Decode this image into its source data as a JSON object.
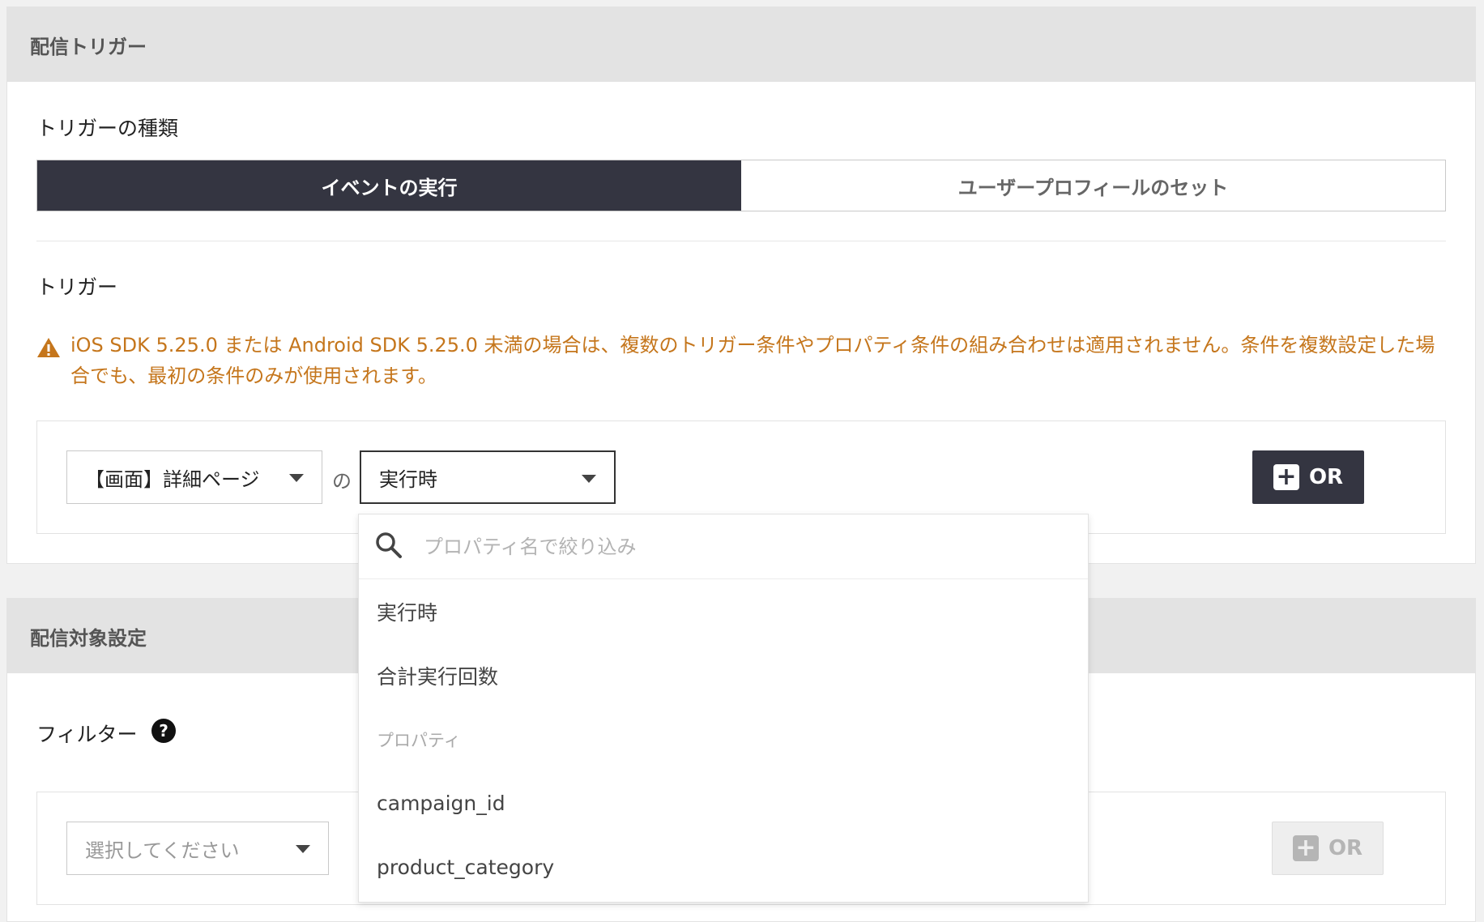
{
  "delivery_trigger_section": {
    "title": "配信トリガー",
    "trigger_type_label": "トリガーの種類",
    "trigger_type_options": [
      {
        "label": "イベントの実行",
        "active": true
      },
      {
        "label": "ユーザープロフィールのセット",
        "active": false
      }
    ],
    "trigger_label": "トリガー",
    "warning": "iOS SDK 5.25.0 または Android SDK 5.25.0 未満の場合は、複数のトリガー条件やプロパティ条件の組み合わせは適用されません。条件を複数設定した場合でも、最初の条件のみが使用されます。",
    "condition": {
      "event_select_value": "【画面】詳細ページ",
      "connector_text": "の",
      "property_select_value": "実行時",
      "or_button_label": "OR"
    }
  },
  "dropdown": {
    "search_placeholder": "プロパティ名で絞り込み",
    "items": [
      "実行時",
      "合計実行回数"
    ],
    "group_label": "プロパティ",
    "property_items": [
      "campaign_id",
      "product_category"
    ]
  },
  "target_section": {
    "title": "配信対象設定",
    "filter_label": "フィルター",
    "help_symbol": "?",
    "filter_select_placeholder": "選択してください",
    "or_button_label": "OR"
  },
  "colors": {
    "dark": "#343541",
    "warning": "#c5761c",
    "header_bg": "#e3e3e3"
  }
}
